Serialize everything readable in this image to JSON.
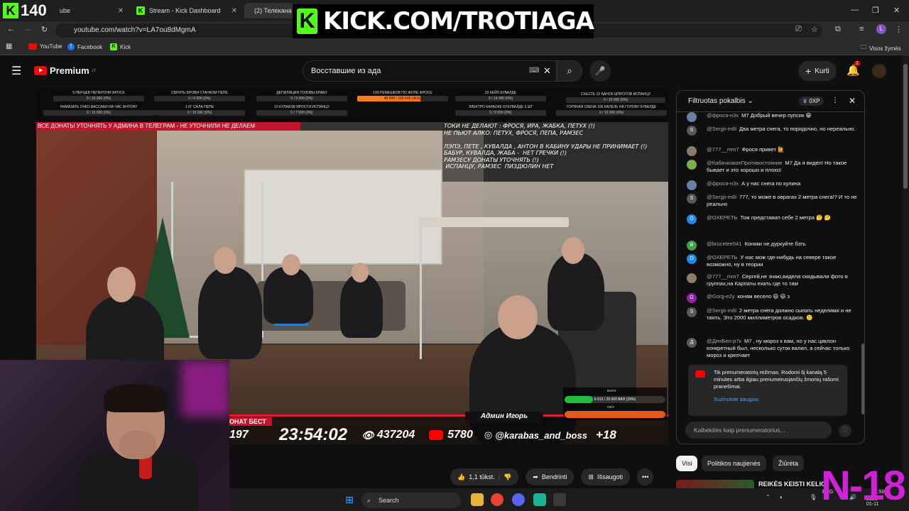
{
  "browser": {
    "tabs": [
      {
        "label": "ube"
      },
      {
        "label": "Stream - Kick Dashboard"
      },
      {
        "label": "(2) Телекана"
      }
    ],
    "url": "youtube.com/watch?v=LA7ou8dMgmA",
    "bookmarks": [
      "YouTube",
      "Facebook",
      "Kick"
    ],
    "bookmarks_right": "Visos žymės"
  },
  "kick_overlay": {
    "viewers": "140",
    "banner_text": "KICK.COM/TROTIAGA"
  },
  "youtube": {
    "brand": "Premium",
    "brand_region": "LT",
    "search_value": "Восставшие из ада",
    "create_label": "Kurti",
    "notifications_count": "2"
  },
  "stream_overlay": {
    "goals": [
      {
        "title": "5 ПЕРЦЕВ ПЕПЕРОНИ ФРОСЕ",
        "progress": "0 / 10 000 (0%)"
      },
      {
        "title": "НАМАЗАТЬ ОЧКО ВАССАБИ НА ЧАС АНТОНУ",
        "progress": "0 / 10 000 (0%)"
      },
      {
        "title": "СБРИТЬ БРОВИ СТАНКОМ ПЕПЕ",
        "progress": "0 / 6 000 (0%)"
      },
      {
        "title": "1 КГ САЛА ПЕПЕ",
        "progress": "0 / 15 000 (0%)"
      },
      {
        "title": "ДЕПИЛЯЦИЯ ГОЛОВЫ КРАБУ",
        "progress": "0 / 5 000 (0%)"
      },
      {
        "title": "10 КУЛАКОВ ЯРОСТИ ИСПАНЦУ",
        "progress": "0 / 7 000 (0%)"
      },
      {
        "title": "100 РЕМЕШКОВ ПО ЖОПЕ ФРОСЕ",
        "progress": "40 500 / 100 000 (41%)"
      },
      {
        "title": "20 КЕЙЛ КУВАЛДЕ",
        "progress": "0 / 14 000 (0%)"
      },
      {
        "title": "ЭЛЕКТРО КАРАОКЕ КУКУВАЛДЕ 3 ШТ",
        "progress": "0 / 9 000 (0%)"
      },
      {
        "title": "СЪЕСТЬ 10 БАНОК ШПРОТОВ ИСПАНЦУ",
        "progress": "0 / 10 000 (0%)"
      },
      {
        "title": "ГОРЯЧАЯ СВЕЧА 100 КАПЕЛЬ НА ГОЛОВУ КУВАЛДЕ",
        "progress": "0 / 10 000 (0%)"
      }
    ],
    "red_banner": "ВСЕ ДОНАТЫ УТОЧНЯТЬ У АДМИНА В ТЕЛЕГРАМ - НЕ УТОЧНИЛИ НЕ ДЕЛАЕМ",
    "rules": "ТОКИ НЕ ДЕЛАЮТ : ФРОСЯ, ИРА, ЖАБКА, ПЕТУХ (!)\nНЕ ПЬЮТ АЛКО: ПЕТУХ, ФРОСЯ, ПЕПА, РАМЗЕС\n\nЛЭПЭ, ПЕТЕ , КУВАЛДА , АНТОН В КАБИНУ УДАРЫ НЕ ПРИНИМАЕТ (!)\nБАБУР, КУВАЛДА, ЖАБА -  НЕТ ГРЕЧКИ (!)\nРАМЗЕСУ ДОНАТЫ УТОЧНЯТЬ (!)\n ИСПАНЦУ, РАМЗЕС  ПИЗДЮЛИН НЕТ",
    "donat_label": "ОНАТ БЕСТ",
    "admin_label": "Админ Игорь",
    "count_left": "197",
    "timer": "23:54:02",
    "views": "437204",
    "yt_count": "5780",
    "instagram": "@karabas_and_boss",
    "age": "+18",
    "don_total_label": "всего",
    "don_total": "6 912 / 25 000 ВАН (28%)",
    "don_total_fill": 0.28,
    "don_today_label": "сего"
  },
  "actions": {
    "likes": "1,1 tūkst.",
    "share": "Bendrinti",
    "save": "Išsaugoti"
  },
  "chat": {
    "title": "Filtruotas pokalbis",
    "points": "0XP",
    "messages": [
      {
        "author": "@фрося-н3х",
        "text": "М7 Добрый вечер пупсик 😁",
        "initial": "",
        "color": "#6b7fa3"
      },
      {
        "author": "@Sergii-m8i",
        "text": "Два метра снега, то порядочно, но нереально.",
        "initial": "S",
        "color": "#5a5a5a"
      },
      {
        "author": "@777__mm7",
        "text": "Фрося привет 🙋",
        "initial": "",
        "color": "#8a7a6a"
      },
      {
        "author": "@КабачковоеПротивостояние",
        "text": "М7 Да я видел! Но такое бывает и это хорошо и плохо!",
        "initial": "",
        "color": "#7ab04a"
      },
      {
        "author": "@фрося-н3х",
        "text": "А у нас снега по кулина",
        "initial": "",
        "color": "#6b7fa3"
      },
      {
        "author": "@Sergii-m8i",
        "text": "777, то може в оврагах 2 метра снега!? И то не реально",
        "initial": "S",
        "color": "#5a5a5a"
      },
      {
        "author": "@OXEPEТЬ",
        "text": "Тож представил себе 2 метра 🤔 🤔",
        "initial": "O",
        "color": "#1e88e5"
      },
      {
        "author": "@brucelee541",
        "text": "Коняки не дуркуйте бэть",
        "initial": "B",
        "color": "#43a047"
      },
      {
        "author": "@OXEPEТЬ",
        "text": "У нас мож где-нибудь на севере такое возможно, ну в теории",
        "initial": "O",
        "color": "#1e88e5"
      },
      {
        "author": "@777__mm7",
        "text": "Сергей,не знаю,видела скидывали фото в группах,на Карпаты ехать где то там",
        "initial": "",
        "color": "#8a7a6a"
      },
      {
        "author": "@Gorg-e2y",
        "text": "коням весело 😃 😃 з",
        "initial": "G",
        "color": "#8e24aa"
      },
      {
        "author": "@Sergii-m8i",
        "text": "2 метра снега должно сыпать неделями и не таять. Это 2000 миллиметров осадков. 🙂",
        "initial": "S",
        "color": "#5a5a5a"
      },
      {
        "author": "@ДенБел-р7к",
        "text": "М7 , ну мороз к вам, но у нас циклон конкретный был, несколько суток валил, а сейчас только мороз и крепчает",
        "initial": "Д",
        "color": "#5a5a5a"
      }
    ],
    "sub_notice": "Tik prenumeratorių režimas. Rodomi šį kanalą 5 minutes arba ilgiau prenumeruojančių žmonių rašomi pranešimai.",
    "sub_link": "Sužinokite daugiau",
    "input_placeholder": "Kalbėkitės kaip prenumeratorius..."
  },
  "chips": [
    "Visi",
    "Politikos naujienės",
    "Žiūrėta"
  ],
  "recommendation_title": "REIKĖS KEISTI KELIO",
  "taskbar": {
    "search": "Search",
    "lang": "ENG",
    "lang2": "LT",
    "time": "21:50",
    "date": "2026-01-11"
  },
  "corner_badge": "N-18",
  "colors": {
    "kick_green": "#53fc18",
    "yt_red": "#ff0000",
    "link_blue": "#3ea6ff",
    "badge_magenta": "#d020d8"
  }
}
